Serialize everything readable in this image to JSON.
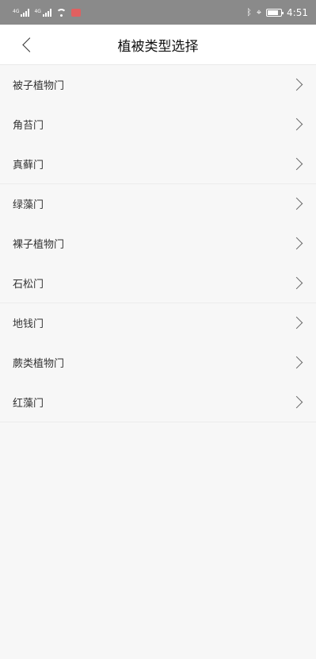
{
  "status_bar": {
    "signal1": "4G",
    "signal2": "4G",
    "battery_level": 0.8,
    "bluetooth_symbol": "ᛒ",
    "location_symbol": "⌖",
    "time": "4:51"
  },
  "header": {
    "title": "植被类型选择"
  },
  "list": [
    {
      "label": "被子植物门",
      "separator": false
    },
    {
      "label": "角苔门",
      "separator": false
    },
    {
      "label": "真藓门",
      "separator": true
    },
    {
      "label": "绿藻门",
      "separator": false
    },
    {
      "label": "裸子植物门",
      "separator": false
    },
    {
      "label": "石松门",
      "separator": true
    },
    {
      "label": "地钱门",
      "separator": false
    },
    {
      "label": "蕨类植物门",
      "separator": false
    },
    {
      "label": "红藻门",
      "separator": true
    }
  ]
}
